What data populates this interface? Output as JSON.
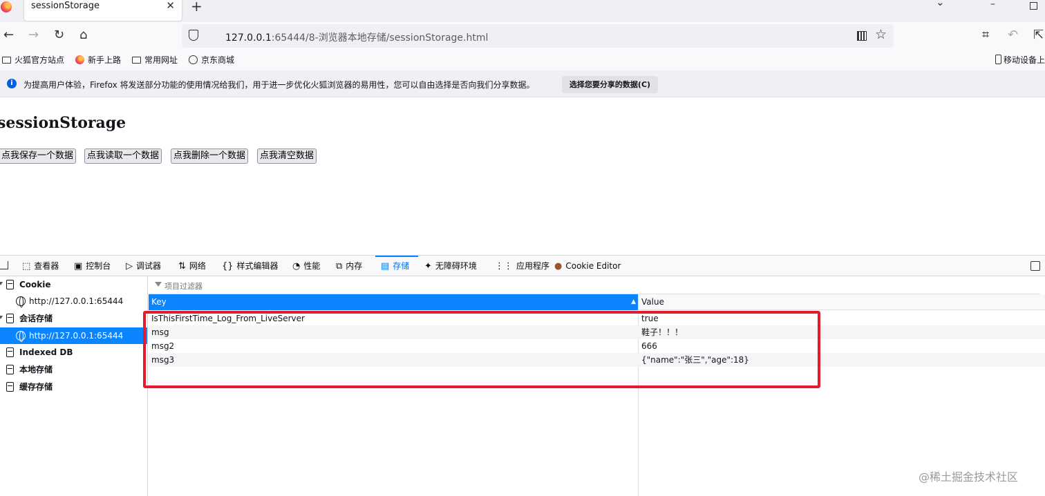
{
  "browser": {
    "tab_title": "sessionStorage",
    "tab_close_icon": "close-icon",
    "new_tab_icon": "plus-icon",
    "url_host": "127.0.0.1",
    "url_rest": ":65444/8-浏览器本地存储/sessionStorage.html"
  },
  "bookmarks": {
    "items": [
      "火狐官方站点",
      "新手上路",
      "常用网址",
      "京东商城"
    ],
    "mobile": "移动设备上"
  },
  "notice": {
    "text": "为提高用户体验，Firefox 将发送部分功能的使用情况给我们，用于进一步优化火狐浏览器的易用性，您可以自由选择是否向我们分享数据。",
    "button": "选择您要分享的数据(C)"
  },
  "page": {
    "heading": "sessionStorage",
    "buttons": [
      "点我保存一个数据",
      "点我读取一个数据",
      "点我删除一个数据",
      "点我清空数据"
    ]
  },
  "devtools": {
    "tabs": [
      "查看器",
      "控制台",
      "调试器",
      "网络",
      "样式编辑器",
      "性能",
      "内存",
      "存储",
      "无障碍环境",
      "应用程序",
      "Cookie Editor"
    ],
    "tab_icons": [
      "inspector-icon",
      "console-icon",
      "debugger-icon",
      "network-icon",
      "style-editor-icon",
      "performance-icon",
      "memory-icon",
      "storage-icon",
      "accessibility-icon",
      "application-icon",
      "cookie-icon"
    ],
    "active_tab": "存储"
  },
  "sidebar": {
    "cookie": "Cookie",
    "cookie_host": "http://127.0.0.1:65444",
    "session": "会话存储",
    "session_host": "http://127.0.0.1:65444",
    "indexed_db": "Indexed DB",
    "local": "本地存储",
    "cache": "缓存存储"
  },
  "table": {
    "filter_placeholder": "项目过滤器",
    "key_header": "Key",
    "value_header": "Value",
    "rows": [
      {
        "key": "IsThisFirstTime_Log_From_LiveServer",
        "value": "true"
      },
      {
        "key": "msg",
        "value": "鞋子！！！"
      },
      {
        "key": "msg2",
        "value": "666"
      },
      {
        "key": "msg3",
        "value": "{\"name\":\"张三\",\"age\":18}"
      }
    ]
  },
  "watermark": "@稀土掘金技术社区",
  "colors": {
    "accent": "#0a84ff",
    "highlight": "#e21c2c"
  }
}
